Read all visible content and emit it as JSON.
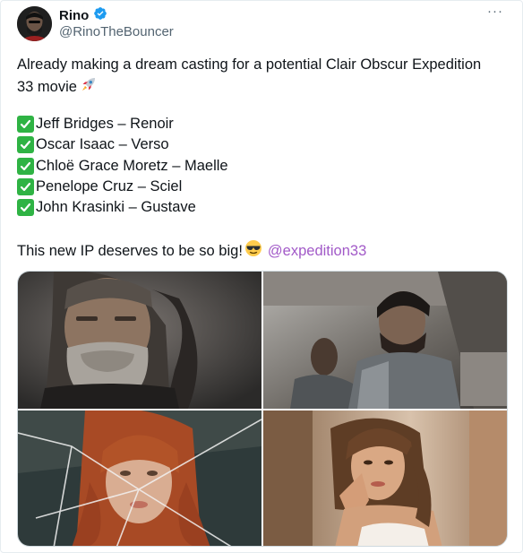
{
  "author": {
    "display_name": "Rino",
    "handle": "@RinoTheBouncer"
  },
  "more_menu": "···",
  "post": {
    "line1": "Already making a dream casting for a potential Clair Obscur Expedition",
    "line2": "33 movie",
    "cast": [
      "Jeff Bridges – Renoir",
      "Oscar Isaac – Verso",
      "Chloë Grace Moretz – Maelle",
      "Penelope Cruz – Sciel",
      "John Krasinki – Gustave"
    ],
    "closing_text": "This new IP deserves to be so big!",
    "mention": "@expedition33"
  },
  "icons": {
    "verified": "verified-badge-icon",
    "rocket": "rocket-emoji-icon",
    "check": "check-mark-emoji-icon",
    "cool": "sunglasses-emoji-icon",
    "more": "more-options-icon"
  },
  "colors": {
    "verified": "#1d9bf0",
    "check": "#2fb344",
    "mention": "#a25ac8",
    "secondary_text": "#536471"
  }
}
